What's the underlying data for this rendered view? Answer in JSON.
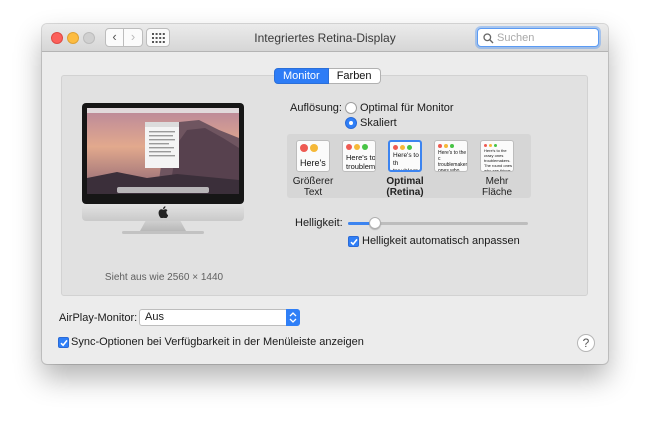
{
  "window": {
    "title": "Integriertes Retina-Display"
  },
  "toolbar": {
    "back_glyph": "‹",
    "forward_glyph": "›",
    "search_placeholder": "Suchen"
  },
  "tabs": [
    {
      "label": "Monitor",
      "active": true
    },
    {
      "label": "Farben",
      "active": false
    }
  ],
  "display": {
    "looks_like": "Sieht aus wie 2560 × 1440"
  },
  "resolution": {
    "label": "Auflösung:",
    "options": [
      {
        "label": "Optimal für Monitor",
        "selected": false
      },
      {
        "label": "Skaliert",
        "selected": true
      }
    ],
    "scales": [
      {
        "preview": "Here's",
        "caption_line1": "Größerer",
        "caption_line2": "Text",
        "selected": false
      },
      {
        "preview": "Here's to troublem",
        "caption_line1": "",
        "caption_line2": "",
        "selected": false
      },
      {
        "preview": "Here's to th troublemak",
        "caption_line1": "Optimal",
        "caption_line2": "(Retina)",
        "selected": true
      },
      {
        "preview": "Here's to the c troublemakers. ones who see t rules. And they",
        "caption_line1": "",
        "caption_line2": "",
        "selected": false
      },
      {
        "preview": "Here's to the crazy ones troublemakers. The round ones who see things di rules. And they have no",
        "caption_line1": "Mehr",
        "caption_line2": "Fläche",
        "selected": false
      }
    ]
  },
  "brightness": {
    "label": "Helligkeit:",
    "level": 0.15,
    "auto_label": "Helligkeit automatisch anpassen",
    "auto_checked": true
  },
  "airplay": {
    "label": "AirPlay-Monitor:",
    "value": "Aus"
  },
  "sync": {
    "label": "Sync-Optionen bei Verfügbarkeit in der Menüleiste anzeigen",
    "checked": true
  },
  "help": {
    "glyph": "?"
  },
  "colors": {
    "accent": "#2f7ff7",
    "close": "#fc605b",
    "minimize": "#fdbc40",
    "zoom": "#d0d0d0"
  }
}
